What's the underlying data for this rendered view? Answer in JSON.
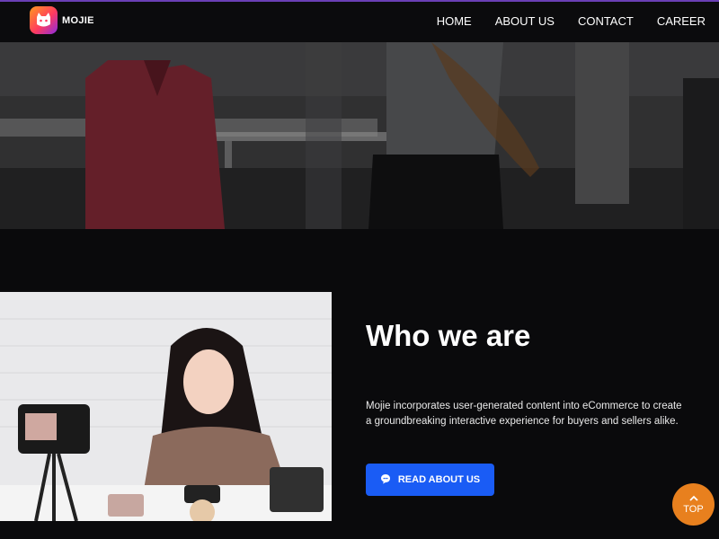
{
  "brand": {
    "name": "MOJIE"
  },
  "nav": {
    "items": [
      {
        "label": "HOME"
      },
      {
        "label": "ABOUT US"
      },
      {
        "label": "CONTACT"
      },
      {
        "label": "CAREER"
      }
    ]
  },
  "about": {
    "title": "Who we are",
    "description": "Mojie incorporates user-generated content into eCommerce to create a groundbreaking interactive experience for buyers and sellers alike.",
    "button_label": "READ ABOUT US"
  },
  "scroll_top": {
    "label": "TOP"
  },
  "colors": {
    "accent_line": "#6a3fb5",
    "button_blue": "#1a5cf5",
    "top_orange": "#e8801e",
    "background": "#0a0a0c"
  },
  "icons": {
    "logo": "cat-face-icon",
    "button": "chat-bubble-icon",
    "top": "chevron-up-icon"
  }
}
